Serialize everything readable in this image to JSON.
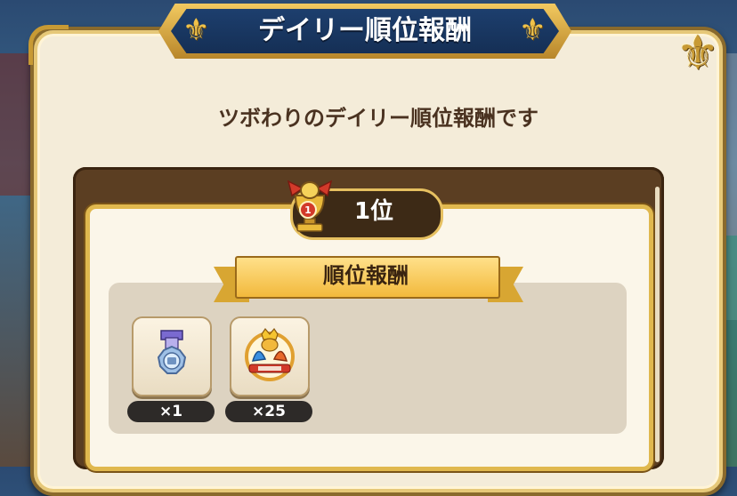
{
  "dialog": {
    "title": "デイリー順位報酬",
    "subtitle": "ツボわりのデイリー順位報酬です"
  },
  "rank": {
    "label": "1位",
    "badge_number": "1"
  },
  "section": {
    "label": "順位報酬"
  },
  "rewards": [
    {
      "icon": "medal-icon",
      "count": "×1"
    },
    {
      "icon": "slime-goal-badge-icon",
      "count": "×25"
    }
  ],
  "colors": {
    "title_bg": "#1d3f6e",
    "gold": "#e0b84e",
    "panel_brown": "#5b3e22",
    "card_bg": "#fbf6e9",
    "count_pill": "#2d2a28"
  }
}
